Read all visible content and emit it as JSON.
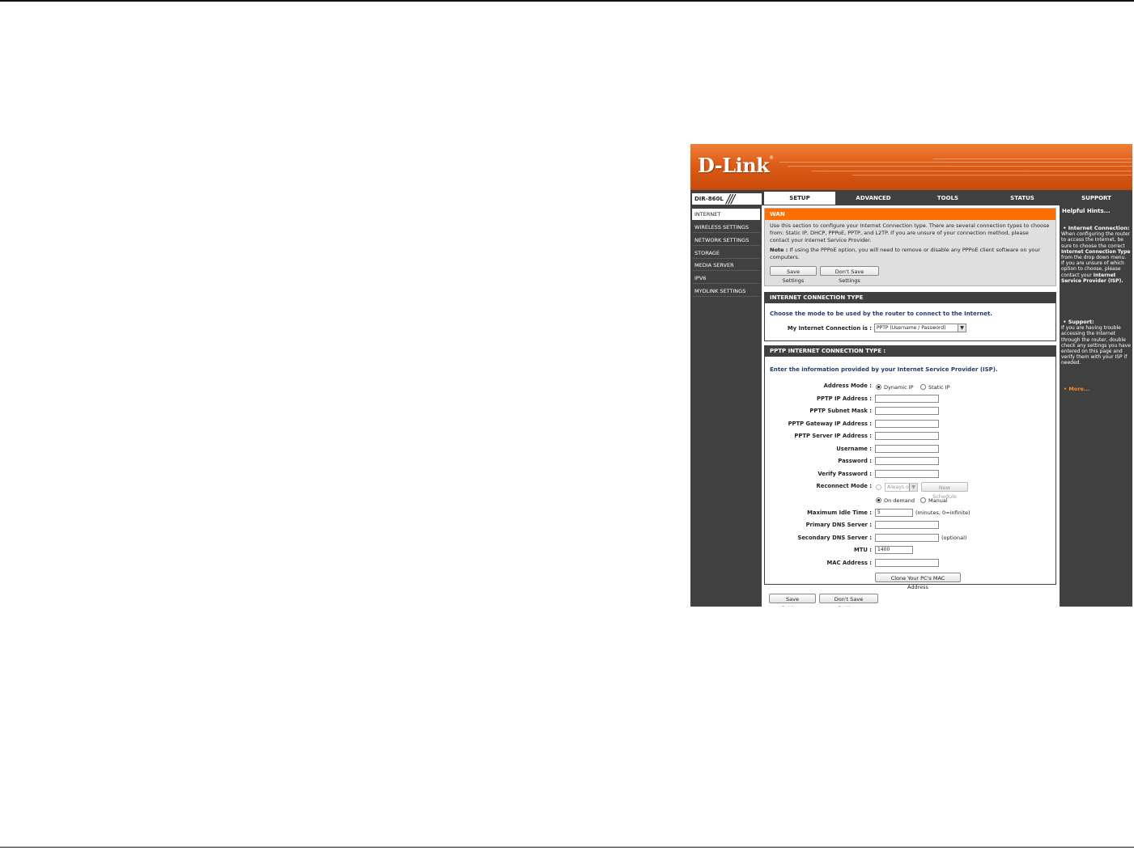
{
  "brand": {
    "logo": "D-Link",
    "registered": "®",
    "model": "DIR-860L"
  },
  "nav": {
    "tabs": [
      {
        "label": "SETUP",
        "active": true
      },
      {
        "label": "ADVANCED",
        "active": false
      },
      {
        "label": "TOOLS",
        "active": false
      },
      {
        "label": "STATUS",
        "active": false
      },
      {
        "label": "SUPPORT",
        "active": false
      }
    ]
  },
  "sidebar": {
    "items": [
      {
        "label": "INTERNET",
        "active": true
      },
      {
        "label": "WIRELESS SETTINGS",
        "active": false
      },
      {
        "label": "NETWORK SETTINGS",
        "active": false
      },
      {
        "label": "STORAGE",
        "active": false
      },
      {
        "label": "MEDIA SERVER",
        "active": false
      },
      {
        "label": "IPV6",
        "active": false
      },
      {
        "label": "MYDLINK SETTINGS",
        "active": false
      }
    ]
  },
  "wan": {
    "title": "WAN",
    "description": "Use this section to configure your Internet Connection type. There are several connection types to choose from: Static IP, DHCP, PPPoE, PPTP, and L2TP. If you are unsure of your connection method, please contact your Internet Service Provider.",
    "note_label": "Note :",
    "note_text": " If using the PPPoE option, you will need to remove or disable any PPPoE client software on your computers.",
    "save_label": "Save Settings",
    "dont_save_label": "Don't Save Settings"
  },
  "connection_type": {
    "title": "INTERNET CONNECTION TYPE",
    "intro": "Choose the mode to be used by the router to connect to the Internet.",
    "label": "My Internet Connection is :",
    "selected": "PPTP (Username / Password)"
  },
  "pptp": {
    "title": "PPTP INTERNET CONNECTION TYPE :",
    "intro": "Enter the information provided by your Internet Service Provider (ISP).",
    "address_mode_label": "Address Mode :",
    "dynamic_ip_label": "Dynamic IP",
    "static_ip_label": "Static IP",
    "ip_address_label": "PPTP IP Address :",
    "subnet_mask_label": "PPTP Subnet Mask :",
    "gateway_label": "PPTP Gateway IP Address :",
    "server_label": "PPTP Server IP Address :",
    "username_label": "Username :",
    "password_label": "Password :",
    "verify_password_label": "Verify Password :",
    "reconnect_mode_label": "Reconnect Mode :",
    "schedule_select_value": "Always o",
    "new_schedule_label": "New Schedule",
    "on_demand_label": "On demand",
    "manual_label": "Manual",
    "idle_time_label": "Maximum Idle Time :",
    "idle_time_value": "5",
    "idle_time_hint": "(minutes, 0=infinite)",
    "primary_dns_label": "Primary DNS Server :",
    "secondary_dns_label": "Secondary DNS Server :",
    "optional_label": "(optional)",
    "mtu_label": "MTU :",
    "mtu_value": "1400",
    "mac_label": "MAC Address :",
    "clone_mac_label": "Clone Your PC's MAC Address"
  },
  "footer": {
    "save_label": "Save Settings",
    "dont_save_label": "Don't Save Settings"
  },
  "hints": {
    "title": "Helpful Hints...",
    "conn_head": "Internet Connection:",
    "conn_text_1": "When configuring the router to access the Internet, be sure to choose the correct ",
    "conn_bold": "Internet Connection Type",
    "conn_text_2": " from the drop down menu. If you are unsure of which option to choose, please contact your ",
    "conn_bold_2": "Internet Service Provider (ISP).",
    "support_head": "Support:",
    "support_text": "If you are having trouble accessing the Internet through the router, double check any settings you have entered on this page and verify them with your ISP if needed.",
    "more": "More..."
  },
  "colors": {
    "brand_orange": "#dd5c16",
    "wan_header": "#ff6f00",
    "nav_dark": "#404040",
    "intro_blue": "#1f3b78",
    "hint_link": "#ff8a1a"
  }
}
